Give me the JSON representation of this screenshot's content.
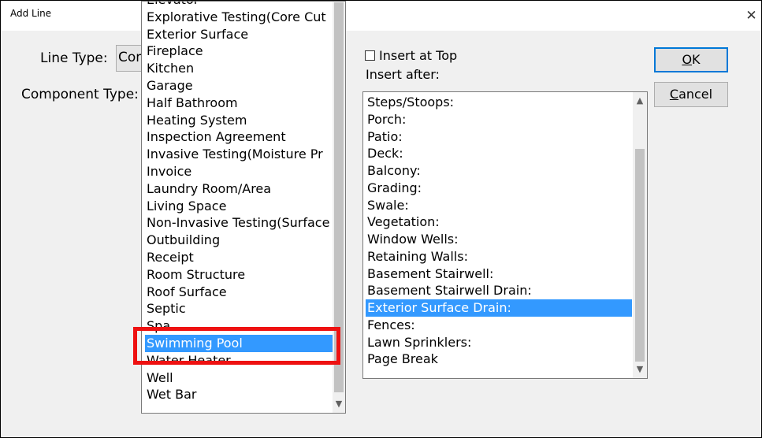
{
  "window": {
    "title": "Add Line",
    "close_glyph": "✕"
  },
  "form": {
    "line_type_label": "Line Type:",
    "line_type_value": "Com",
    "component_type_label": "Component Type:"
  },
  "dropdown": {
    "items": [
      "Elevator",
      "Explorative Testing(Core Cut",
      "Exterior Surface",
      "Fireplace",
      "Kitchen",
      "Garage",
      "Half Bathroom",
      "Heating System",
      "Inspection Agreement",
      "Invasive Testing(Moisture Pr",
      "Invoice",
      "Laundry Room/Area",
      "Living Space",
      "Non-Invasive Testing(Surface",
      "Outbuilding",
      "Receipt",
      "Room Structure",
      "Roof Surface",
      "Septic",
      "Spa",
      "Swimming Pool",
      "Water Heater",
      "Well",
      "Wet Bar"
    ],
    "selected_index": 20
  },
  "insert": {
    "insert_at_top_label": "Insert at Top",
    "insert_at_top_checked": false,
    "insert_after_label": "Insert after:",
    "items": [
      "Steps/Stoops:",
      "Porch:",
      "Patio:",
      "Deck:",
      "Balcony:",
      "Grading:",
      "Swale:",
      "Vegetation:",
      "Window Wells:",
      "Retaining Walls:",
      "Basement Stairwell:",
      "Basement Stairwell Drain:",
      "Exterior Surface Drain:",
      "Fences:",
      "Lawn Sprinklers:",
      "Page Break"
    ],
    "selected_index": 12
  },
  "buttons": {
    "ok_mnemonic": "O",
    "ok_rest": "K",
    "cancel_mnemonic": "C",
    "cancel_rest": "ancel"
  },
  "icons": {
    "scroll_up": "chevron-up-icon",
    "scroll_down": "chevron-down-icon",
    "close": "close-icon"
  },
  "colors": {
    "selection": "#3399ff",
    "highlight_frame": "#ee1111",
    "default_button_border": "#0078d7"
  }
}
